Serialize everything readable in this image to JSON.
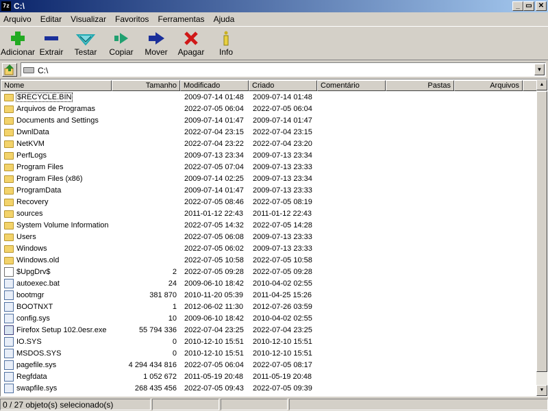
{
  "window": {
    "title": "C:\\",
    "app_icon": "7z"
  },
  "menu": [
    "Arquivo",
    "Editar",
    "Visualizar",
    "Favoritos",
    "Ferramentas",
    "Ajuda"
  ],
  "toolbar": [
    {
      "label": "Adicionar",
      "icon": "plus-icon",
      "color": "#22aa22"
    },
    {
      "label": "Extrair",
      "icon": "minus-icon",
      "color": "#1a2f9a"
    },
    {
      "label": "Testar",
      "icon": "check-icon",
      "color": "#20a8b0"
    },
    {
      "label": "Copiar",
      "icon": "copy-arrow-icon",
      "color": "#20a070"
    },
    {
      "label": "Mover",
      "icon": "move-arrow-icon",
      "color": "#1a2f9a"
    },
    {
      "label": "Apagar",
      "icon": "delete-x-icon",
      "color": "#d01818"
    },
    {
      "label": "Info",
      "icon": "info-icon",
      "color": "#c8b020"
    }
  ],
  "address": {
    "path": "C:\\"
  },
  "columns": [
    "Nome",
    "Tamanho",
    "Modificado",
    "Criado",
    "Comentário",
    "Pastas",
    "Arquivos"
  ],
  "files": [
    {
      "name": "$RECYCLE.BIN",
      "size": "",
      "modified": "2009-07-14 01:48",
      "created": "2009-07-14 01:48",
      "type": "folder"
    },
    {
      "name": "Arquivos de Programas",
      "size": "",
      "modified": "2022-07-05 06:04",
      "created": "2022-07-05 06:04",
      "type": "folder"
    },
    {
      "name": "Documents and Settings",
      "size": "",
      "modified": "2009-07-14 01:47",
      "created": "2009-07-14 01:47",
      "type": "folder"
    },
    {
      "name": "DwnlData",
      "size": "",
      "modified": "2022-07-04 23:15",
      "created": "2022-07-04 23:15",
      "type": "folder"
    },
    {
      "name": "NetKVM",
      "size": "",
      "modified": "2022-07-04 23:22",
      "created": "2022-07-04 23:20",
      "type": "folder"
    },
    {
      "name": "PerfLogs",
      "size": "",
      "modified": "2009-07-13 23:34",
      "created": "2009-07-13 23:34",
      "type": "folder"
    },
    {
      "name": "Program Files",
      "size": "",
      "modified": "2022-07-05 07:04",
      "created": "2009-07-13 23:33",
      "type": "folder"
    },
    {
      "name": "Program Files (x86)",
      "size": "",
      "modified": "2009-07-14 02:25",
      "created": "2009-07-13 23:34",
      "type": "folder"
    },
    {
      "name": "ProgramData",
      "size": "",
      "modified": "2009-07-14 01:47",
      "created": "2009-07-13 23:33",
      "type": "folder"
    },
    {
      "name": "Recovery",
      "size": "",
      "modified": "2022-07-05 08:46",
      "created": "2022-07-05 08:19",
      "type": "folder"
    },
    {
      "name": "sources",
      "size": "",
      "modified": "2011-01-12 22:43",
      "created": "2011-01-12 22:43",
      "type": "folder"
    },
    {
      "name": "System Volume Information",
      "size": "",
      "modified": "2022-07-05 14:32",
      "created": "2022-07-05 14:28",
      "type": "folder"
    },
    {
      "name": "Users",
      "size": "",
      "modified": "2022-07-05 06:08",
      "created": "2009-07-13 23:33",
      "type": "folder"
    },
    {
      "name": "Windows",
      "size": "",
      "modified": "2022-07-05 06:02",
      "created": "2009-07-13 23:33",
      "type": "folder"
    },
    {
      "name": "Windows.old",
      "size": "",
      "modified": "2022-07-05 10:58",
      "created": "2022-07-05 10:58",
      "type": "folder"
    },
    {
      "name": "$UpgDrv$",
      "size": "2",
      "modified": "2022-07-05 09:28",
      "created": "2022-07-05 09:28",
      "type": "file"
    },
    {
      "name": "autoexec.bat",
      "size": "24",
      "modified": "2009-06-10 18:42",
      "created": "2010-04-02 02:55",
      "type": "sys"
    },
    {
      "name": "bootmgr",
      "size": "381 870",
      "modified": "2010-11-20 05:39",
      "created": "2011-04-25 15:26",
      "type": "sys"
    },
    {
      "name": "BOOTNXT",
      "size": "1",
      "modified": "2012-06-02 11:30",
      "created": "2012-07-26 03:59",
      "type": "sys"
    },
    {
      "name": "config.sys",
      "size": "10",
      "modified": "2009-06-10 18:42",
      "created": "2010-04-02 02:55",
      "type": "sys"
    },
    {
      "name": "Firefox Setup 102.0esr.exe",
      "size": "55 794 336",
      "modified": "2022-07-04 23:25",
      "created": "2022-07-04 23:25",
      "type": "exe"
    },
    {
      "name": "IO.SYS",
      "size": "0",
      "modified": "2010-12-10 15:51",
      "created": "2010-12-10 15:51",
      "type": "sys"
    },
    {
      "name": "MSDOS.SYS",
      "size": "0",
      "modified": "2010-12-10 15:51",
      "created": "2010-12-10 15:51",
      "type": "sys"
    },
    {
      "name": "pagefile.sys",
      "size": "4 294 434 816",
      "modified": "2022-07-05 06:04",
      "created": "2022-07-05 08:17",
      "type": "sys"
    },
    {
      "name": "Regfdata",
      "size": "1 052 672",
      "modified": "2011-05-19 20:48",
      "created": "2011-05-19 20:48",
      "type": "sys"
    },
    {
      "name": "swapfile.sys",
      "size": "268 435 456",
      "modified": "2022-07-05 09:43",
      "created": "2022-07-05 09:39",
      "type": "sys"
    }
  ],
  "status": {
    "text": "0 / 27 objeto(s) selecionado(s)"
  }
}
